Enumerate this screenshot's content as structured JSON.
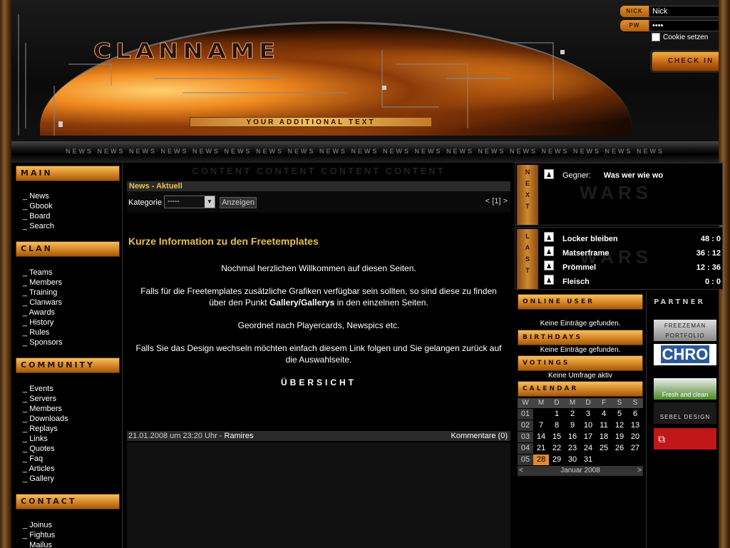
{
  "header": {
    "logo_text": "CLANNAME",
    "additional_text": "YOUR ADDITIONAL TEXT"
  },
  "login": {
    "nick_label": "NICK",
    "nick_value": "Nick",
    "pw_label": "PW",
    "pw_value": "••••",
    "cookie_label": "Cookie setzen",
    "checkin_label": "CHECK IN"
  },
  "newsbar": {
    "text": "NEWS NEWS NEWS NEWS NEWS NEWS NEWS NEWS NEWS NEWS NEWS NEWS NEWS NEWS NEWS NEWS NEWS NEWS NEWS"
  },
  "nav": {
    "main": {
      "title": "MAIN",
      "items": [
        "News",
        "Gbook",
        "Board",
        "Search"
      ]
    },
    "clan": {
      "title": "CLAN",
      "items": [
        "Teams",
        "Members",
        "Training",
        "Clanwars",
        "Awards",
        "History",
        "Rules",
        "Sponsors"
      ]
    },
    "community": {
      "title": "COMMUNITY",
      "items": [
        "Events",
        "Servers",
        "Members",
        "Downloads",
        "Replays",
        "Links",
        "Quotes",
        "Faq",
        "Articles",
        "Gallery"
      ]
    },
    "contact": {
      "title": "CONTACT",
      "items": [
        "Joinus",
        "Fightus",
        "Mailus"
      ]
    }
  },
  "content": {
    "ghost": "CONTENT CONTENT CONTENT CONTENT",
    "section_title": "News - Aktuell",
    "filter_label": "Kategorie",
    "filter_value": "-----",
    "filter_button": "Anzeigen",
    "pager": "< [1] >",
    "article": {
      "title": "Kurze Information zu den Freetemplates",
      "p1": "Nochmal herzlichen Willkommen auf diesen Seiten.",
      "p2a": "Falls für die Freetemplates zusätzliche Grafiken verfügbar sein sollten, so sind diese zu finden über den Punkt ",
      "p2b": "Gallery/Gallerys",
      "p2c": " in den einzelnen Seiten.",
      "p3": "Geordnet nach Playercards, Newspics etc.",
      "p4": "Falls Sie das Design wechseln möchten einfach diesem Link folgen und Sie gelangen zurück auf die Auswahlseite.",
      "link": "ÜBERSICHT"
    },
    "footer": {
      "date": "21.01.2008 um 23:20 Uhr - ",
      "author": "Ramires",
      "comments": "Kommentare (0)"
    }
  },
  "wars": {
    "next_tab": "NEXT",
    "last_tab": "LAST",
    "ghost": "WARS",
    "next_label": "Gegner:",
    "next_value": "Was wer wie wo",
    "last": [
      {
        "name": "Locker bleiben",
        "score": "48 :   0"
      },
      {
        "name": "Matserframe",
        "score": "36 : 12"
      },
      {
        "name": "Prömmel",
        "score": "12 : 36"
      },
      {
        "name": "Fleisch",
        "score": "0 :   0"
      }
    ]
  },
  "side": {
    "online_title": "ONLINE USER",
    "online_text": "Keine Einträge gefunden.",
    "birthdays_title": "BIRTHDAYS",
    "birthdays_text": "Keine Einträge gefunden.",
    "votings_title": "VOTINGS",
    "votings_text": "Keine Umfrage aktiv",
    "calendar_title": "CALENDAR"
  },
  "calendar": {
    "headers": [
      "W",
      "M",
      "D",
      "M",
      "D",
      "F",
      "S",
      "S"
    ],
    "weeks": [
      {
        "w": "01",
        "days": [
          "",
          "1",
          "2",
          "3",
          "4",
          "5",
          "6"
        ]
      },
      {
        "w": "02",
        "days": [
          "7",
          "8",
          "9",
          "10",
          "11",
          "12",
          "13"
        ]
      },
      {
        "w": "03",
        "days": [
          "14",
          "15",
          "16",
          "17",
          "18",
          "19",
          "20"
        ]
      },
      {
        "w": "04",
        "days": [
          "21",
          "22",
          "23",
          "24",
          "25",
          "26",
          "27"
        ]
      },
      {
        "w": "05",
        "days": [
          "28",
          "29",
          "30",
          "31",
          "",
          "",
          ""
        ]
      }
    ],
    "today": "28",
    "month": "Januar 2008",
    "prev": "<",
    "next": ">"
  },
  "partner": {
    "title": "PARTNER",
    "logos": [
      "FREEZEMAN PORTFOLIO",
      "CHRO",
      "Fresh and clean",
      "SEBEL DESIGN",
      ""
    ]
  },
  "colors": {
    "accent": "#e8c050",
    "gold": "#d08020",
    "today": "#e08a30"
  }
}
